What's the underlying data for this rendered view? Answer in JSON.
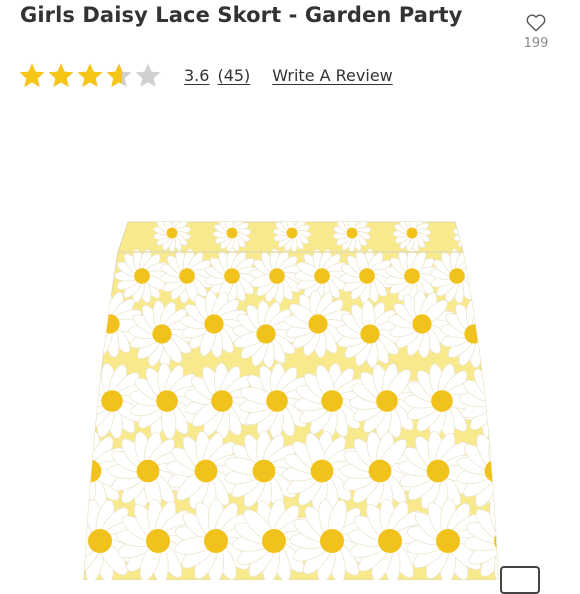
{
  "product": {
    "title": "Girls Daisy Lace Skort - Garden Party"
  },
  "favorite": {
    "icon": "heart-outline-icon",
    "count": "199"
  },
  "rating": {
    "value": "3.6",
    "count": "(45)",
    "stars_filled": 3.6,
    "stars_total": 5,
    "star_color": "#f5c518",
    "empty_star_color": "#d0d0d0"
  },
  "review": {
    "link_label": "Write A Review"
  },
  "image": {
    "subject": "daisy-lace-skort-photo",
    "colors": {
      "petal": "#ffffff",
      "center": "#f1c21b",
      "lining": "#f7e98c"
    }
  }
}
